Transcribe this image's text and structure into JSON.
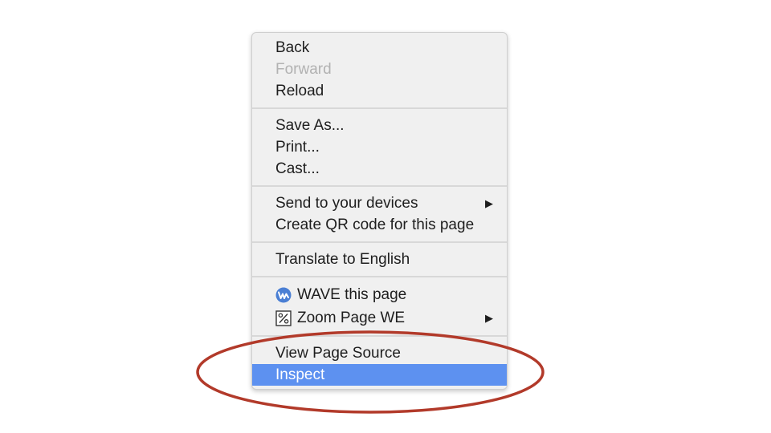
{
  "context_menu": {
    "groups": [
      {
        "items": [
          {
            "label": "Back",
            "disabled": false
          },
          {
            "label": "Forward",
            "disabled": true
          },
          {
            "label": "Reload",
            "disabled": false
          }
        ]
      },
      {
        "items": [
          {
            "label": "Save As..."
          },
          {
            "label": "Print..."
          },
          {
            "label": "Cast..."
          }
        ]
      },
      {
        "items": [
          {
            "label": "Send to your devices",
            "submenu": true
          },
          {
            "label": "Create QR code for this page"
          }
        ]
      },
      {
        "items": [
          {
            "label": "Translate to English"
          }
        ]
      },
      {
        "items": [
          {
            "label": "WAVE this page",
            "icon": "wave-icon"
          },
          {
            "label": "Zoom Page WE",
            "icon": "zoom-percent-icon",
            "submenu": true
          }
        ]
      },
      {
        "items": [
          {
            "label": "View Page Source"
          },
          {
            "label": "Inspect",
            "highlighted": true
          }
        ]
      }
    ],
    "submenu_arrow_glyph": "▶"
  },
  "colors": {
    "menu_background": "#f0f0f0",
    "highlight": "#5d91f0",
    "disabled_text": "#b2b2b2",
    "annotation_circle": "#b23a2a",
    "wave_icon": "#4a7fd4"
  }
}
